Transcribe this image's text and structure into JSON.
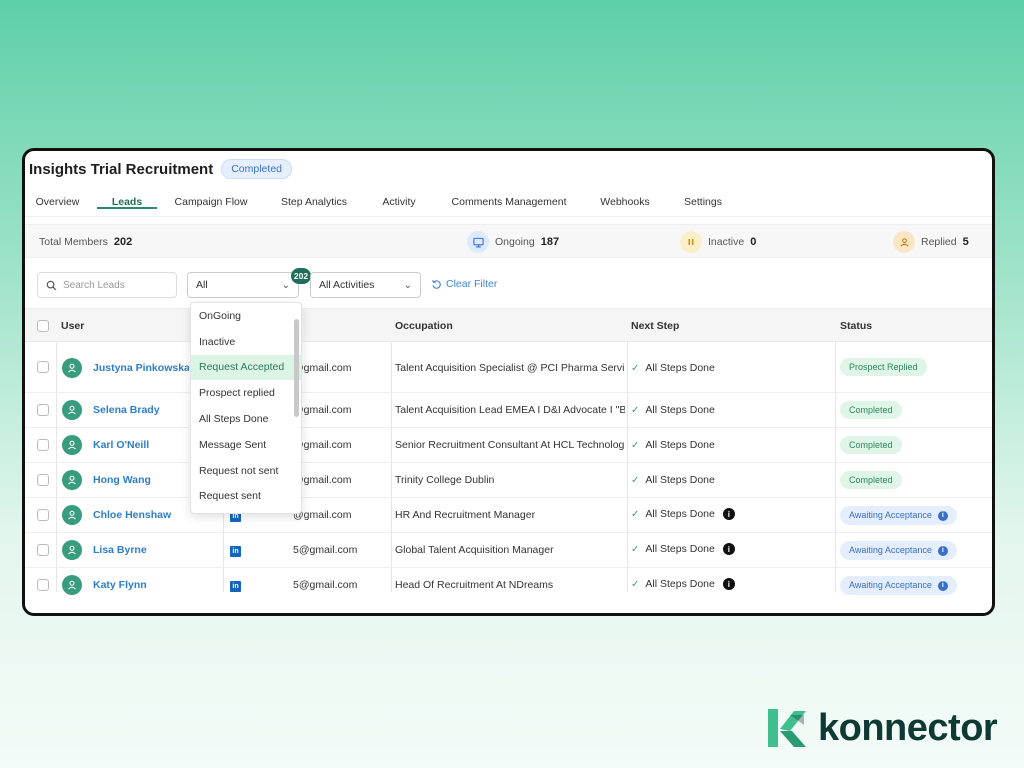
{
  "header": {
    "title": "Insights Trial Recruitment",
    "status": "Completed"
  },
  "tabs": [
    {
      "label": "Overview"
    },
    {
      "label": "Leads"
    },
    {
      "label": "Campaign Flow"
    },
    {
      "label": "Step Analytics"
    },
    {
      "label": "Activity"
    },
    {
      "label": "Comments Management"
    },
    {
      "label": "Webhooks"
    },
    {
      "label": "Settings"
    }
  ],
  "stats": {
    "total_label": "Total Members",
    "total_value": "202",
    "ongoing_label": "Ongoing",
    "ongoing_value": "187",
    "inactive_label": "Inactive",
    "inactive_value": "0",
    "replied_label": "Replied",
    "replied_value": "5"
  },
  "filters": {
    "search_placeholder": "Search Leads",
    "status_value": "All",
    "status_count": "202",
    "activity_value": "All Activities",
    "clear_label": "Clear Filter"
  },
  "dropdown": {
    "options": [
      "OnGoing",
      "Inactive",
      "Request Accepted",
      "Prospect replied",
      "All Steps Done",
      "Message Sent",
      "Request not sent",
      "Request sent"
    ],
    "highlighted": "Request Accepted"
  },
  "table": {
    "headers": {
      "user": "User",
      "occupation": "Occupation",
      "next_step": "Next Step",
      "status": "Status"
    },
    "rows": [
      {
        "name": "Justyna Pinkowska",
        "email": "@gmail.com",
        "occupation": "Talent Acquisition Specialist @ PCI Pharma Services",
        "next_step": "All Steps Done",
        "status": "Prospect Replied"
      },
      {
        "name": "Selena Brady",
        "email": "@gmail.com",
        "occupation": "Talent Acquisition Lead EMEA I D&I Advocate I \"Betv",
        "next_step": "All Steps Done",
        "status": "Completed"
      },
      {
        "name": "Karl O'Neill",
        "email": "@gmail.com",
        "occupation": "Senior Recruitment Consultant At HCL Technologie",
        "next_step": "All Steps Done",
        "status": "Completed"
      },
      {
        "name": "Hong Wang",
        "email": "@gmail.com",
        "occupation": "Trinity College Dublin",
        "next_step": "All Steps Done",
        "status": "Completed"
      },
      {
        "name": "Chloe Henshaw",
        "email": "@gmail.com",
        "occupation": "HR And Recruitment Manager",
        "next_step": "All Steps Done",
        "status": "Awaiting Acceptance"
      },
      {
        "name": "Lisa Byrne",
        "email": "5@gmail.com",
        "occupation": "Global Talent Acquisition Manager",
        "next_step": "All Steps Done",
        "status": "Awaiting Acceptance"
      },
      {
        "name": "Katy Flynn",
        "email": "5@gmail.com",
        "occupation": "Head Of Recruitment At NDreams",
        "next_step": "All Steps Done",
        "status": "Awaiting Acceptance"
      }
    ]
  },
  "brand": {
    "name": "konnector"
  },
  "colors": {
    "accent": "#1f6e5b",
    "link": "#2d7ec9",
    "brand_dark": "#0f3a33",
    "brand_green": "#3fbf8f"
  }
}
